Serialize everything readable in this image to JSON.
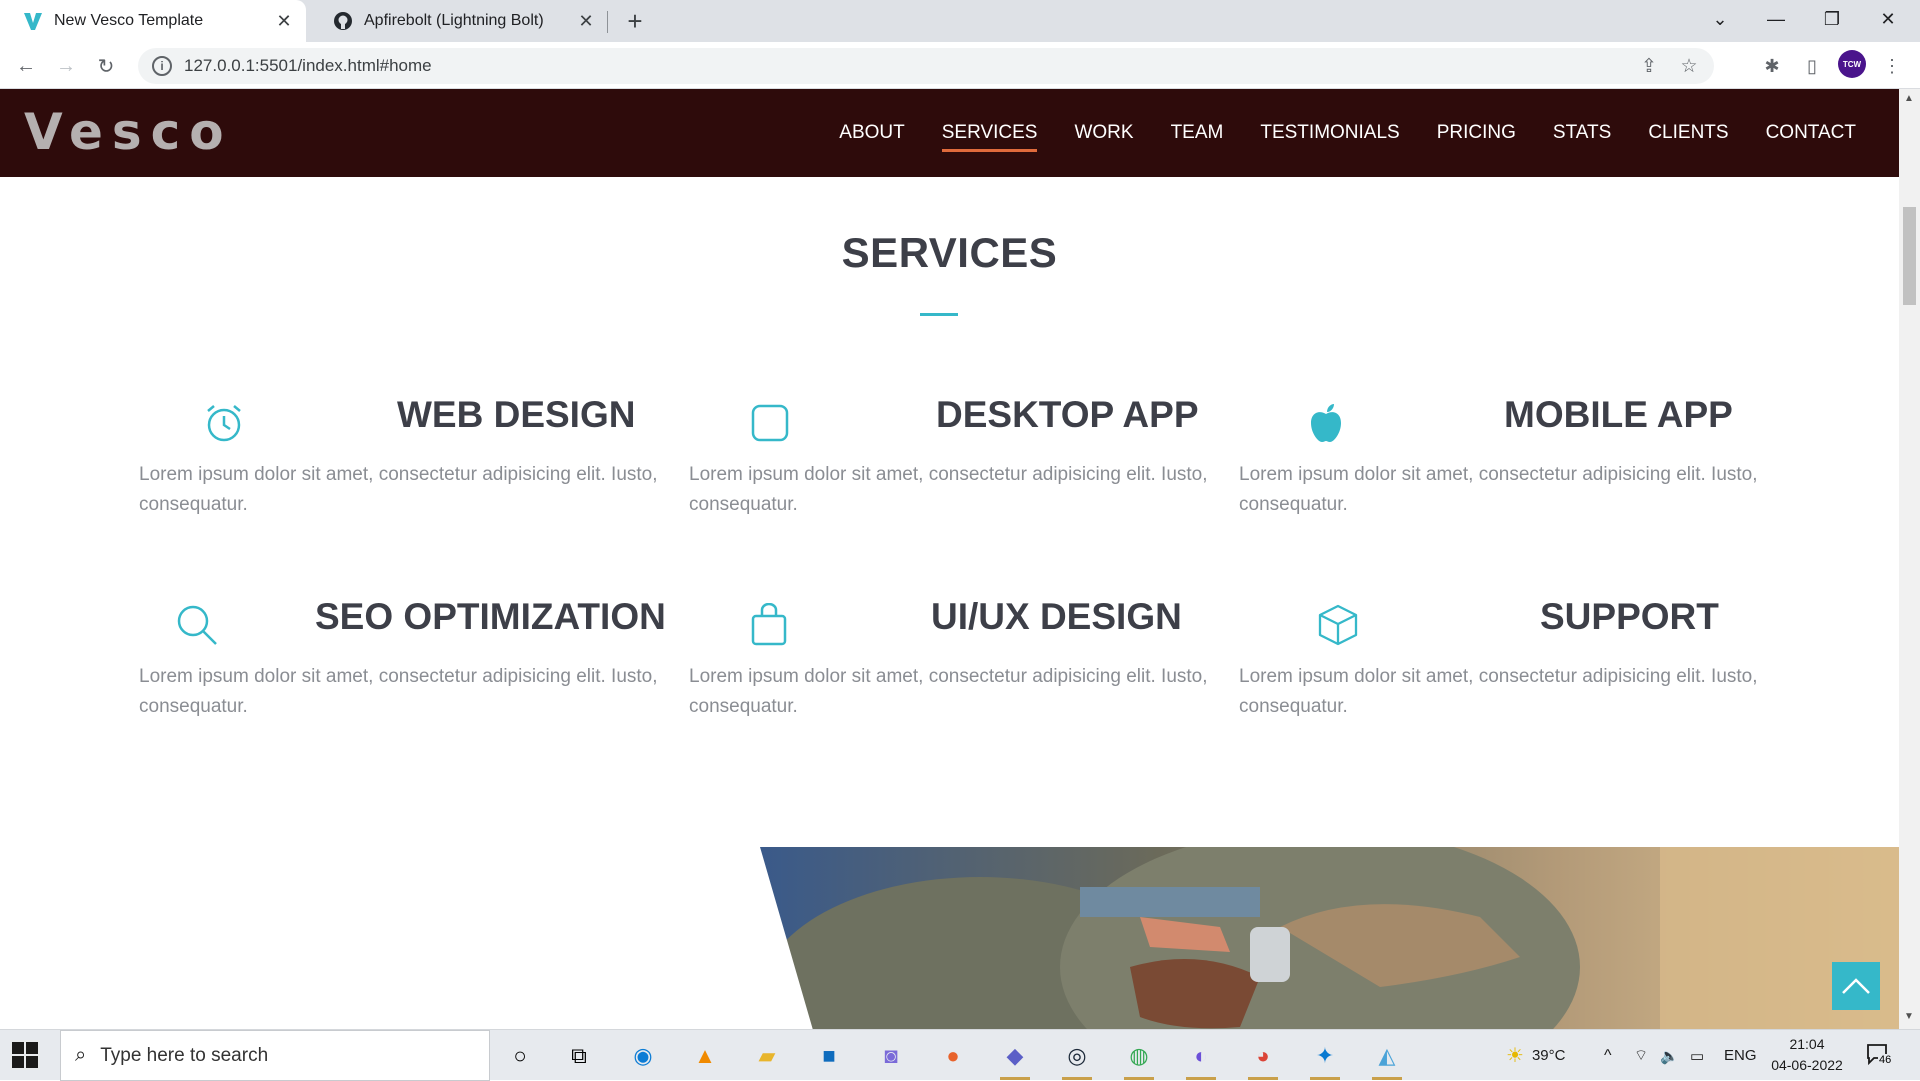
{
  "browser": {
    "tabs": [
      {
        "title": "New Vesco Template",
        "favicon": "vesco-icon",
        "active": true
      },
      {
        "title": "Apfirebolt (Lightning Bolt)",
        "favicon": "github-icon",
        "active": false
      }
    ],
    "url": "127.0.0.1:5501/index.html#home",
    "avatar_text": "TCW"
  },
  "site": {
    "logo": "Vesco",
    "nav": [
      {
        "label": "ABOUT",
        "active": false
      },
      {
        "label": "SERVICES",
        "active": true
      },
      {
        "label": "WORK",
        "active": false
      },
      {
        "label": "TEAM",
        "active": false
      },
      {
        "label": "TESTIMONIALS",
        "active": false
      },
      {
        "label": "PRICING",
        "active": false
      },
      {
        "label": "STATS",
        "active": false
      },
      {
        "label": "CLIENTS",
        "active": false
      },
      {
        "label": "CONTACT",
        "active": false
      }
    ],
    "section_title": "SERVICES",
    "services": [
      {
        "title": "WEB DESIGN",
        "icon": "alarm-clock-icon",
        "desc": "Lorem ipsum dolor sit amet, consectetur adipisicing elit. Iusto, consequatur."
      },
      {
        "title": "DESKTOP APP",
        "icon": "square-icon",
        "desc": "Lorem ipsum dolor sit amet, consectetur adipisicing elit. Iusto, consequatur."
      },
      {
        "title": "MOBILE APP",
        "icon": "apple-icon",
        "desc": "Lorem ipsum dolor sit amet, consectetur adipisicing elit. Iusto, consequatur."
      },
      {
        "title": "SEO OPTIMIZATION",
        "icon": "search-icon",
        "desc": "Lorem ipsum dolor sit amet, consectetur adipisicing elit. Iusto, consequatur."
      },
      {
        "title": "UI/UX DESIGN",
        "icon": "shopping-bag-icon",
        "desc": "Lorem ipsum dolor sit amet, consectetur adipisicing elit. Iusto, consequatur."
      },
      {
        "title": "SUPPORT",
        "icon": "cube-icon",
        "desc": "Lorem ipsum dolor sit amet, consectetur adipisicing elit. Iusto, consequatur."
      }
    ],
    "accent_color": "#35b8c9",
    "nav_bg_color": "#2e0b0b"
  },
  "taskbar": {
    "search_placeholder": "Type here to search",
    "weather": "39°C",
    "language": "ENG",
    "time": "21:04",
    "date": "04-06-2022",
    "notifications": "46"
  }
}
